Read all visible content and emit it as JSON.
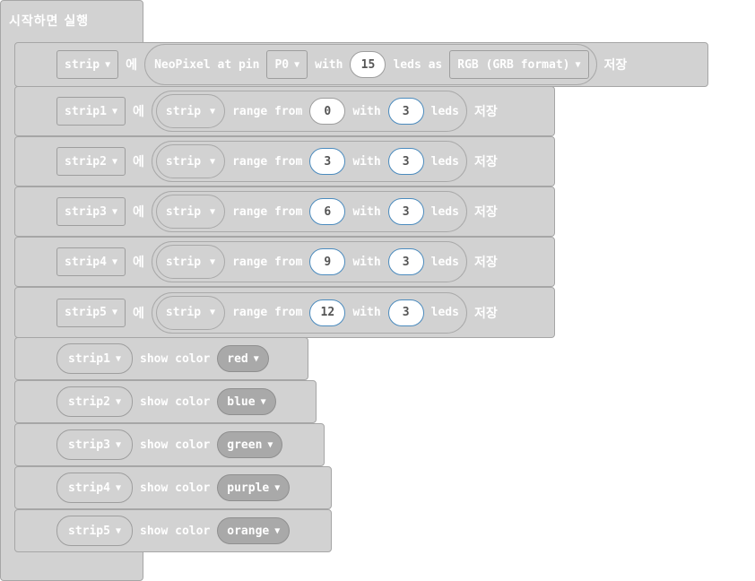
{
  "hat": {
    "label": "시작하면 실행"
  },
  "neopixel": {
    "var": "strip",
    "assign": "에",
    "text1": "NeoPixel at pin",
    "pin": "P0",
    "with": "with",
    "count": "15",
    "leds_as": "leds as",
    "format": "RGB (GRB format)",
    "save": "저장"
  },
  "ranges": [
    {
      "var": "strip1",
      "assign": "에",
      "source": "strip",
      "range_from": "range from",
      "start": "0",
      "with": "with",
      "len": "3",
      "leds": "leds",
      "save": "저장"
    },
    {
      "var": "strip2",
      "assign": "에",
      "source": "strip",
      "range_from": "range from",
      "start": "3",
      "with": "with",
      "len": "3",
      "leds": "leds",
      "save": "저장"
    },
    {
      "var": "strip3",
      "assign": "에",
      "source": "strip",
      "range_from": "range from",
      "start": "6",
      "with": "with",
      "len": "3",
      "leds": "leds",
      "save": "저장"
    },
    {
      "var": "strip4",
      "assign": "에",
      "source": "strip",
      "range_from": "range from",
      "start": "9",
      "with": "with",
      "len": "3",
      "leds": "leds",
      "save": "저장"
    },
    {
      "var": "strip5",
      "assign": "에",
      "source": "strip",
      "range_from": "range from",
      "start": "12",
      "with": "with",
      "len": "3",
      "leds": "leds",
      "save": "저장"
    }
  ],
  "shows": [
    {
      "var": "strip1",
      "label": "show color",
      "color": "red"
    },
    {
      "var": "strip2",
      "label": "show color",
      "color": "blue"
    },
    {
      "var": "strip3",
      "label": "show color",
      "color": "green"
    },
    {
      "var": "strip4",
      "label": "show color",
      "color": "purple"
    },
    {
      "var": "strip5",
      "label": "show color",
      "color": "orange"
    }
  ],
  "icons": {
    "dropdown": "caret-down-icon"
  },
  "colors": {
    "block": "#d2d2d2",
    "block_border": "#a6a6a6",
    "color_dd": "#a9a9a9",
    "num_border_blue": "#4b8bbe"
  }
}
